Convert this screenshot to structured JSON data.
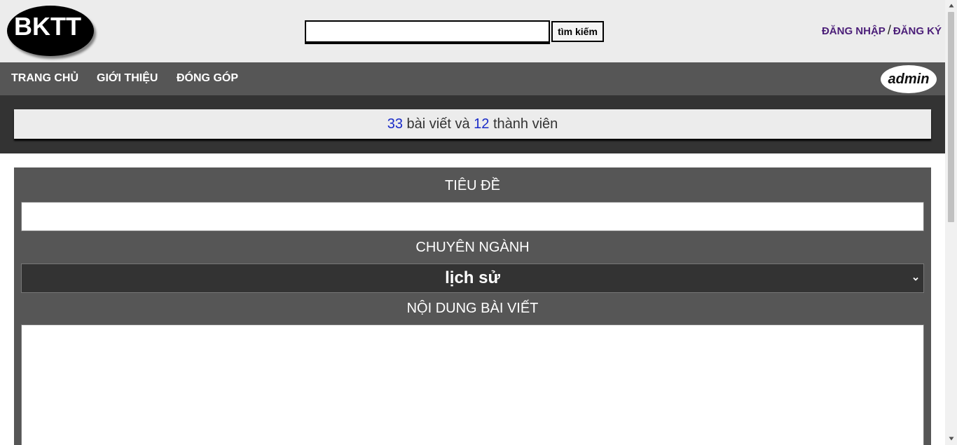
{
  "header": {
    "logo_text": "BKTT",
    "search": {
      "value": "",
      "placeholder": "",
      "button_label": "tìm kiếm"
    },
    "auth": {
      "login_label": "ĐĂNG NHẬP",
      "separator": "/",
      "register_label": "ĐĂNG KÝ"
    }
  },
  "navbar": {
    "items": [
      {
        "label": "TRANG CHỦ"
      },
      {
        "label": "GIỚI THIỆU"
      },
      {
        "label": "ĐÓNG GÓP"
      }
    ],
    "user_label": "admin"
  },
  "stats": {
    "posts_count": "33",
    "posts_text": "bài viết và",
    "members_count": "12",
    "members_text": "thành viên"
  },
  "form": {
    "title_label": "TIÊU ĐỀ",
    "title_value": "",
    "major_label": "CHUYÊN NGÀNH",
    "major_selected": "lịch sử",
    "content_label": "NỘI DUNG BÀI VIẾT",
    "content_value": ""
  },
  "colors": {
    "header_bg": "#ececec",
    "navbar_bg": "#565656",
    "band_bg": "#333333",
    "link_purple": "#4b1e78",
    "count_blue": "#1a2bc8"
  },
  "icons": {
    "select_arrow": "chevron-down-icon",
    "scroll_up": "scroll-up-arrow-icon",
    "scroll_down": "scroll-down-arrow-icon"
  }
}
